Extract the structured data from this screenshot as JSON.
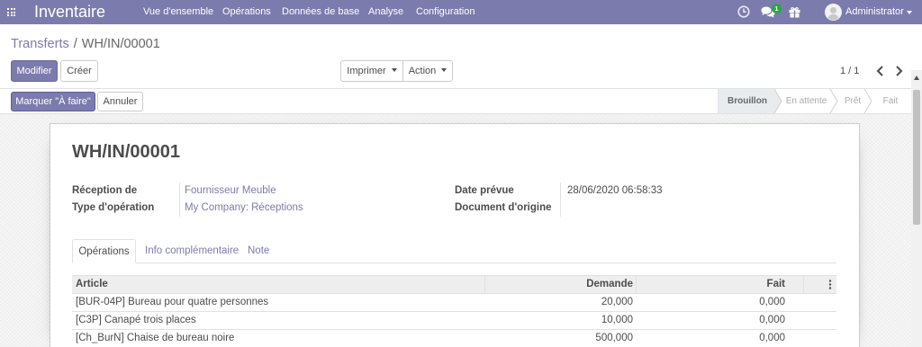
{
  "navbar": {
    "app_name": "Inventaire",
    "menu": [
      "Vue d'ensemble",
      "Opérations",
      "Données de base",
      "Analyse",
      "Configuration"
    ],
    "chat_badge": "1",
    "user_name": "Administrator",
    "icons": {
      "apps": "apps-grid-icon",
      "activity": "clock-icon",
      "messages": "chat-icon",
      "updates": "gift-icon",
      "user": "avatar-icon"
    }
  },
  "breadcrumb": {
    "parent": "Transferts",
    "separator": "/",
    "current": "WH/IN/00001"
  },
  "control_panel": {
    "edit_label": "Modifier",
    "create_label": "Créer",
    "print_label": "Imprimer",
    "action_label": "Action",
    "pager": "1 / 1"
  },
  "statusbar": {
    "buttons": [
      "Marquer \"À faire\"",
      "Annuler"
    ],
    "stages": [
      {
        "label": "Brouillon",
        "active": true
      },
      {
        "label": "En attente",
        "active": false
      },
      {
        "label": "Prêt",
        "active": false
      },
      {
        "label": "Fait",
        "active": false
      }
    ]
  },
  "form": {
    "title": "WH/IN/00001",
    "fields_left": [
      {
        "label": "Réception de",
        "value": "Fournisseur Meuble"
      },
      {
        "label": "Type d'opération",
        "value": "My Company: Réceptions"
      }
    ],
    "fields_right": [
      {
        "label": "Date prévue",
        "value": "28/06/2020 06:58:33"
      },
      {
        "label": "Document d'origine",
        "value": ""
      }
    ],
    "tabs": [
      {
        "label": "Opérations",
        "active": true
      },
      {
        "label": "Info complémentaire",
        "active": false
      },
      {
        "label": "Note",
        "active": false
      }
    ],
    "table": {
      "columns": [
        "Article",
        "Demande",
        "Fait"
      ],
      "rows": [
        [
          "[BUR-04P] Bureau pour quatre personnes",
          "20,000",
          "0,000"
        ],
        [
          "[C3P] Canapé trois places",
          "10,000",
          "0,000"
        ],
        [
          "[Ch_BurN] Chaise de bureau noire",
          "500,000",
          "0,000"
        ]
      ]
    }
  },
  "colors": {
    "brand": "#7C7BAD",
    "badge": "#28a745",
    "statusbar_active_bg": "#e9ecef"
  }
}
